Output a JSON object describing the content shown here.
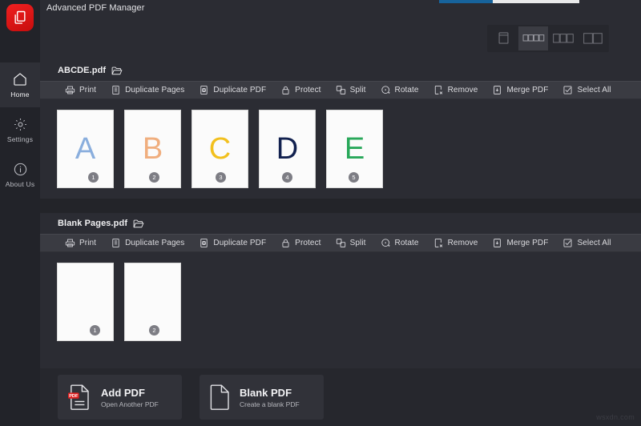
{
  "app": {
    "title": "Advanced PDF Manager",
    "logo_icon": "pdf-copy-logo-icon",
    "accent_color": "#e02020",
    "background_color": "#2b2c33",
    "toolbar_color": "#3a3b42"
  },
  "top_progress": {
    "icon": "loading-progress-bar",
    "percent": 38,
    "fill_color": "#17639c",
    "track_color": "#e9e9ea"
  },
  "sidebar": {
    "items": [
      {
        "label": "Home",
        "icon": "home-icon",
        "active": true
      },
      {
        "label": "Settings",
        "icon": "gear-icon",
        "active": false
      },
      {
        "label": "About Us",
        "icon": "info-circle-icon",
        "active": false
      }
    ]
  },
  "view_modes": {
    "options": [
      {
        "name": "single-page-view",
        "icon": "single-page-icon",
        "active": false
      },
      {
        "name": "list-view",
        "icon": "list-rows-icon",
        "active": true
      },
      {
        "name": "three-column-view",
        "icon": "three-column-icon",
        "active": false
      },
      {
        "name": "two-column-view",
        "icon": "two-column-icon",
        "active": false
      }
    ]
  },
  "toolbar_actions": [
    {
      "label": "Print",
      "icon": "printer-icon"
    },
    {
      "label": "Duplicate Pages",
      "icon": "duplicate-pages-icon"
    },
    {
      "label": "Duplicate PDF",
      "icon": "duplicate-pdf-icon"
    },
    {
      "label": "Protect",
      "icon": "lock-icon"
    },
    {
      "label": "Split",
      "icon": "split-icon"
    },
    {
      "label": "Rotate",
      "icon": "rotate-icon"
    },
    {
      "label": "Remove",
      "icon": "remove-x-icon"
    },
    {
      "label": "Merge PDF",
      "icon": "merge-pdf-icon"
    },
    {
      "label": "Select All",
      "icon": "checkbox-check-icon"
    }
  ],
  "documents": [
    {
      "name": "ABCDE.pdf",
      "folder_icon": "open-folder-icon",
      "pages": [
        {
          "number": "1",
          "letter": "A",
          "color": "#8aaedd"
        },
        {
          "number": "2",
          "letter": "B",
          "color": "#f0ae7e"
        },
        {
          "number": "3",
          "letter": "C",
          "color": "#f2c01e"
        },
        {
          "number": "4",
          "letter": "D",
          "color": "#12214f"
        },
        {
          "number": "5",
          "letter": "E",
          "color": "#29a85a"
        }
      ]
    },
    {
      "name": "Blank Pages.pdf",
      "folder_icon": "open-folder-icon",
      "pages": [
        {
          "number": "1",
          "letter": "",
          "color": ""
        },
        {
          "number": "2",
          "letter": "",
          "color": ""
        }
      ]
    }
  ],
  "bottom_actions": [
    {
      "title": "Add PDF",
      "subtitle": "Open Another PDF",
      "icon": "pdf-file-add-icon"
    },
    {
      "title": "Blank PDF",
      "subtitle": "Create a blank PDF",
      "icon": "blank-file-icon"
    }
  ],
  "watermark": {
    "text": "wsxdn.com"
  }
}
